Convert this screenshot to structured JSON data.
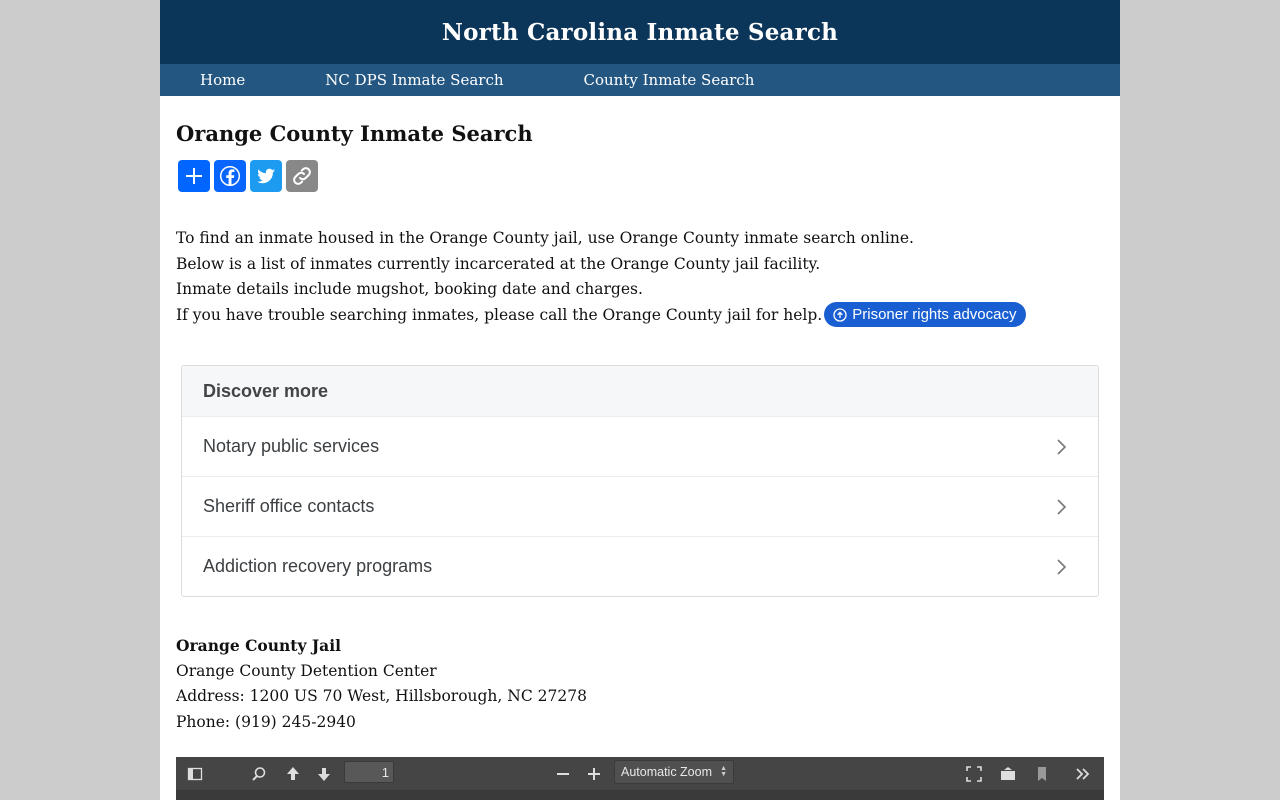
{
  "header": {
    "title": "North Carolina Inmate Search"
  },
  "nav": [
    {
      "label": "Home"
    },
    {
      "label": "NC DPS Inmate Search"
    },
    {
      "label": "County Inmate Search"
    }
  ],
  "page": {
    "title": "Orange County Inmate Search"
  },
  "share": {
    "buttons": [
      {
        "icon": "plus-icon",
        "color": "#0166ff"
      },
      {
        "icon": "facebook-icon",
        "color": "#0866ff"
      },
      {
        "icon": "twitter-icon",
        "color": "#1d9bf0"
      },
      {
        "icon": "link-icon",
        "color": "#888888"
      }
    ]
  },
  "intro": {
    "lines": [
      "To find an inmate housed in the Orange County jail, use Orange County inmate search online.",
      "Below is a list of inmates currently incarcerated at the Orange County jail facility.",
      "Inmate details include mugshot, booking date and charges.",
      "If you have trouble searching inmates, please call the Orange County jail for help."
    ],
    "chip_label": "Prisoner rights advocacy"
  },
  "discover": {
    "heading": "Discover more",
    "items": [
      {
        "label": "Notary public services"
      },
      {
        "label": "Sheriff office contacts"
      },
      {
        "label": "Addiction recovery programs"
      }
    ]
  },
  "jail": {
    "name": "Orange County Jail",
    "facility": "Orange County Detention Center",
    "address": "Address: 1200 US 70 West, Hillsborough, NC 27278",
    "phone": "Phone: (919) 245-2940"
  },
  "pdf_viewer": {
    "page_number": "1",
    "zoom": "Automatic Zoom"
  }
}
